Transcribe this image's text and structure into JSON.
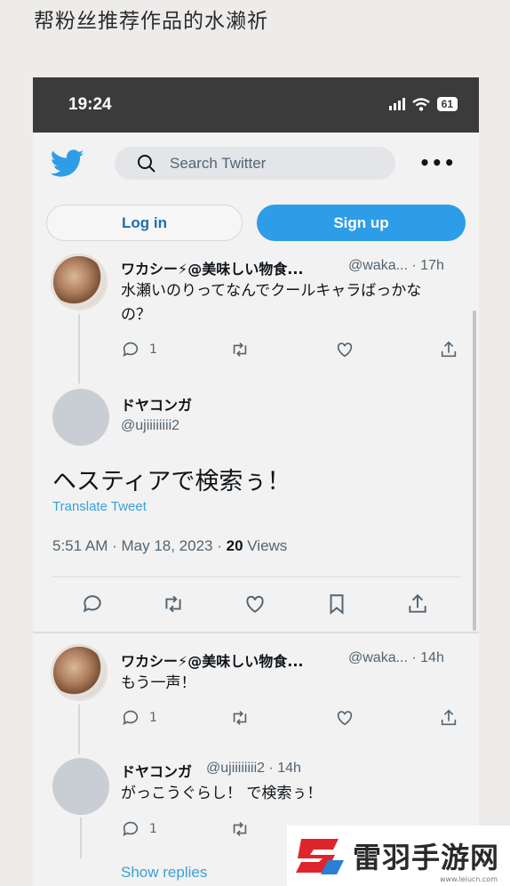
{
  "page_title": "帮粉丝推荐作品的水濑祈",
  "status_bar": {
    "time": "19:24",
    "battery": "61"
  },
  "header": {
    "search_placeholder": "Search Twitter",
    "more": "•••"
  },
  "auth": {
    "login": "Log in",
    "signup": "Sign up"
  },
  "tweet1": {
    "name": "ワカシー⚡@美味しい物食...",
    "handle": "@waka... · 17h",
    "text": "水瀬いのりってなんでクールキャラばっかなの？",
    "reply_count": "1"
  },
  "main_tweet": {
    "name": "ドヤコンガ",
    "handle": "@ujiiiiiiii2",
    "text": "ヘスティアで検索ぅ！",
    "translate": "Translate Tweet",
    "meta_prefix": "5:51 AM · May 18, 2023 · ",
    "views_count": "20",
    "views_label": " Views"
  },
  "reply1": {
    "name": "ワカシー⚡@美味しい物食...",
    "handle": "@waka... · 14h",
    "text": "もう一声！",
    "reply_count": "1"
  },
  "reply2": {
    "name": "ドヤコンガ",
    "handle": "@ujiiiiiiii2 · 14h",
    "text": "がっこうぐらし！ で検索ぅ！",
    "reply_count": "1"
  },
  "show_replies": "Show replies",
  "watermark": {
    "text": "雷羽手游网",
    "url": "www.leiucn.com"
  },
  "colors": {
    "twitter_blue": "#2d9de7",
    "link_blue": "#3aa0d8",
    "status_bar": "#3b3b3b"
  }
}
